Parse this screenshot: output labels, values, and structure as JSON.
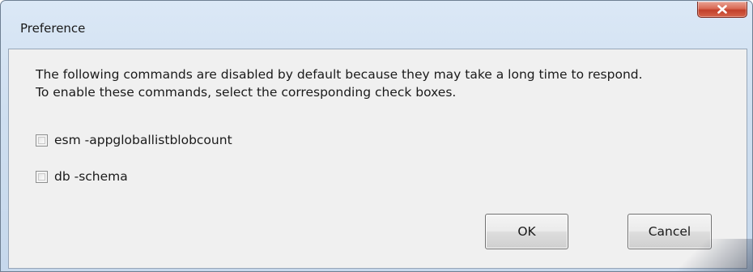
{
  "window": {
    "title": "Preference"
  },
  "titlebar": {
    "close_icon": "close-x-icon"
  },
  "dialog": {
    "description_line1": "The following commands are disabled by default because they may take a long time to respond.",
    "description_line2": "To enable these commands, select the corresponding check boxes.",
    "options": [
      {
        "label": "esm -appgloballistblobcount",
        "checked": false
      },
      {
        "label": "db -schema",
        "checked": false
      }
    ]
  },
  "buttons": {
    "ok_label": "OK",
    "cancel_label": "Cancel"
  },
  "colors": {
    "close_button": "#c2402a",
    "titlebar_glass": "#cfdff0",
    "client_background": "#f0f0f0"
  }
}
